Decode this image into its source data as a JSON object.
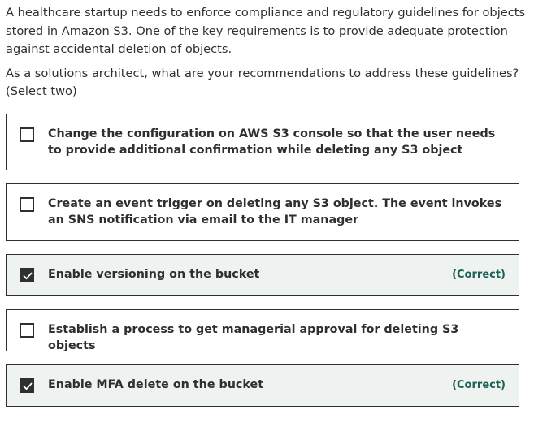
{
  "question": {
    "paragraph1": "A healthcare startup needs to enforce compliance and regulatory guidelines for objects stored in Amazon S3. One of the key requirements is to provide adequate protection against accidental deletion of objects.",
    "paragraph2": "As a solutions architect, what are your recommendations to address these guidelines? (Select two)"
  },
  "options": [
    {
      "text": "Change the configuration on AWS S3 console so that the user needs to provide additional confirmation while deleting any S3 object",
      "checked": false,
      "correct_label": ""
    },
    {
      "text": "Create an event trigger on deleting any S3 object. The event invokes an SNS notification via email to the IT manager",
      "checked": false,
      "correct_label": ""
    },
    {
      "text": "Enable versioning on the bucket",
      "checked": true,
      "correct_label": "(Correct)"
    },
    {
      "text": "Establish a process to get managerial approval for deleting S3 objects",
      "checked": false,
      "correct_label": ""
    },
    {
      "text": "Enable MFA delete on the bucket",
      "checked": true,
      "correct_label": "(Correct)"
    }
  ],
  "colors": {
    "text": "#2d2f31",
    "correct_background": "#eef3f1",
    "correct_label": "#1e6055"
  },
  "icons": {
    "checked": "check-icon"
  }
}
